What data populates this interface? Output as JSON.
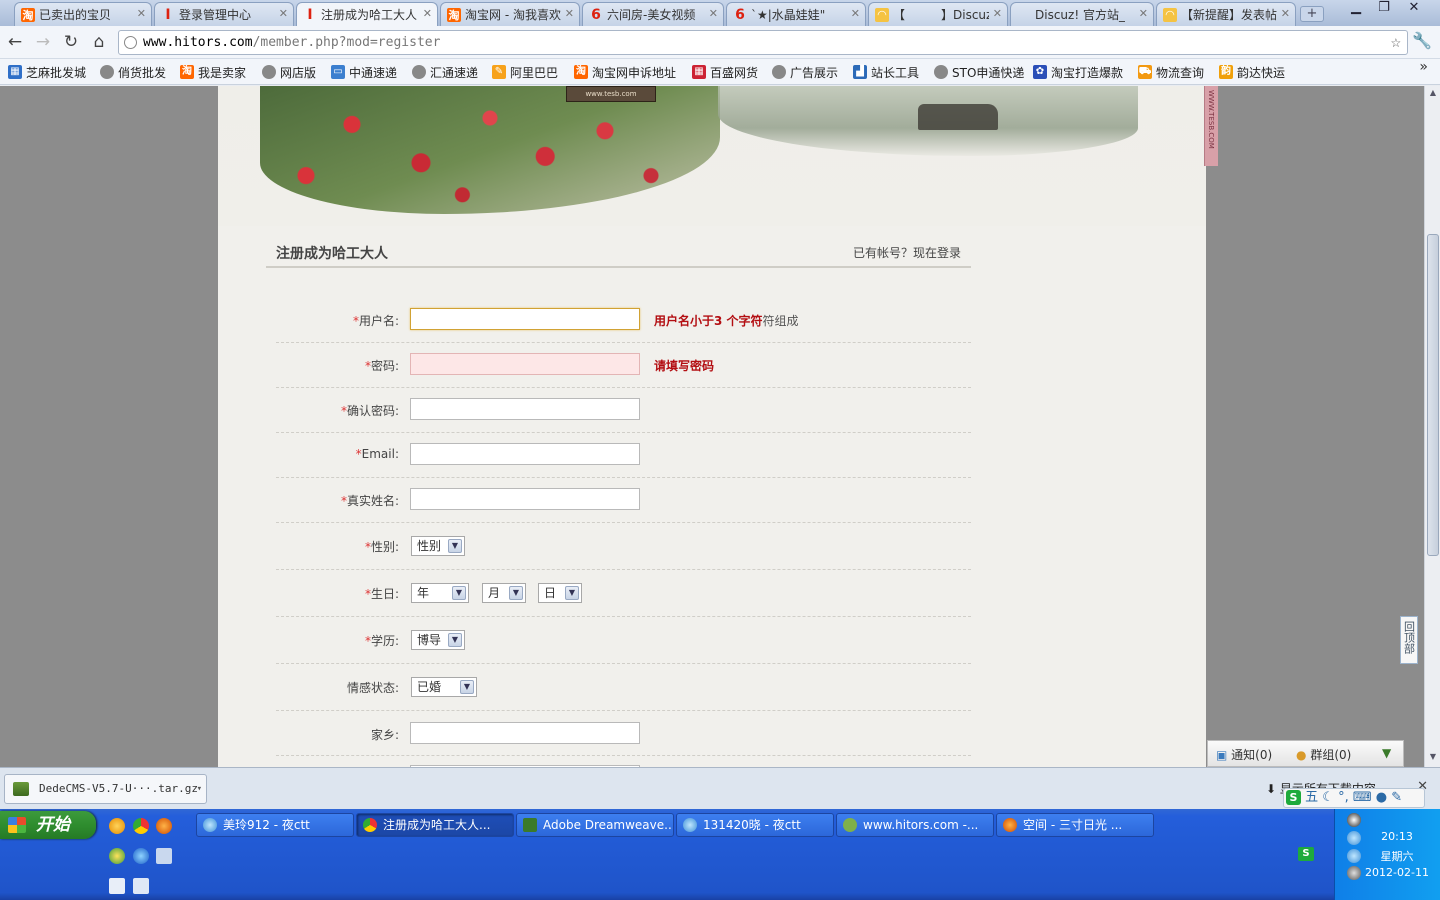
{
  "browser": {
    "tabs": [
      {
        "label": "已卖出的宝贝",
        "icon": "taobao-icon",
        "active": false
      },
      {
        "label": "登录管理中心",
        "icon": "dede-icon",
        "active": false
      },
      {
        "label": "注册成为哈工大人",
        "icon": "dede-icon",
        "active": true
      },
      {
        "label": "淘宝网 - 淘我喜欢",
        "icon": "taobao-icon",
        "active": false
      },
      {
        "label": "六间房-美女视频",
        "icon": "6rooms-icon",
        "active": false
      },
      {
        "label": "`★|水晶娃娃\"",
        "icon": "6rooms-icon",
        "active": false
      },
      {
        "label": "【　　　】Discuz",
        "icon": "discuz-icon",
        "active": false
      },
      {
        "label": "Discuz! 官方站_",
        "icon": "",
        "active": false
      },
      {
        "label": "【新提醒】发表帖",
        "icon": "discuz-icon",
        "active": false
      }
    ],
    "url": {
      "host": "www.hitors.com",
      "path": "/member.php?mod=register"
    },
    "bookmarks": [
      {
        "label": "芝麻批发城",
        "icon": "store-icon"
      },
      {
        "label": "俏货批发",
        "icon": "globe-icon"
      },
      {
        "label": "我是卖家",
        "icon": "taobao-icon"
      },
      {
        "label": "网店版",
        "icon": "globe-icon"
      },
      {
        "label": "中通速递",
        "icon": "zto-icon"
      },
      {
        "label": "汇通速递",
        "icon": "globe-icon"
      },
      {
        "label": "阿里巴巴",
        "icon": "alibaba-icon"
      },
      {
        "label": "淘宝网申诉地址",
        "icon": "taobao-icon"
      },
      {
        "label": "百盛网货",
        "icon": "grid-icon"
      },
      {
        "label": "广告展示",
        "icon": "globe-icon"
      },
      {
        "label": "站长工具",
        "icon": "chart-icon"
      },
      {
        "label": "STO申通快递",
        "icon": "globe-icon"
      },
      {
        "label": "淘宝打造爆款",
        "icon": "paw-icon"
      },
      {
        "label": "物流查询",
        "icon": "cart-icon"
      },
      {
        "label": "韵达快运",
        "icon": "yunda-icon"
      }
    ]
  },
  "page": {
    "banner_sign": "www.tesb.com",
    "side_tag": "WWW.TESB.COM",
    "form_title": "注册成为哈工大人",
    "login_link": "已有帐号？现在登录",
    "required_mark": "*",
    "fields": {
      "username": {
        "label": "用户名:",
        "msg_bold": "用户名小于3 个字符",
        "msg_gray": "符组成"
      },
      "password": {
        "label": "密码:",
        "msg_bold": "请填写密码"
      },
      "confirm": {
        "label": "确认密码:"
      },
      "email": {
        "label": "Email:"
      },
      "realname": {
        "label": "真实姓名:"
      },
      "gender": {
        "label": "性别:",
        "value": "性别"
      },
      "birthday": {
        "label": "生日:",
        "year": "年",
        "month": "月",
        "day": "日"
      },
      "education": {
        "label": "学历:",
        "value": "博导"
      },
      "relationship": {
        "label": "情感状态:",
        "value": "已婚"
      },
      "hometown": {
        "label": "家乡:"
      }
    },
    "back_to_top": "回顶部",
    "notify": {
      "notice": "通知(0)",
      "group": "群组(0)"
    }
  },
  "download_bar": {
    "file": "DedeCMS-V5.7-U···.tar.gz",
    "show_all": "显示所有下载内容"
  },
  "ime": {
    "label": "五"
  },
  "taskbar": {
    "start": "开始",
    "tasks": [
      {
        "label": "美玲912 - 夜ctt",
        "active": false
      },
      {
        "label": "注册成为哈工大人...",
        "active": true
      },
      {
        "label": "Adobe Dreamweave...",
        "active": false
      },
      {
        "label": "131420晓 - 夜ctt",
        "active": false
      },
      {
        "label": "www.hitors.com -...",
        "active": false
      },
      {
        "label": "空间 - 三寸日光 ...",
        "active": false
      }
    ],
    "clock": {
      "time": "20:13",
      "weekday": "星期六",
      "date": "2012-02-11"
    }
  },
  "colors": {
    "error_text": "#b30e12",
    "required": "#dd3333",
    "taskbar": "#245edb",
    "start": "#2f8d2f"
  }
}
